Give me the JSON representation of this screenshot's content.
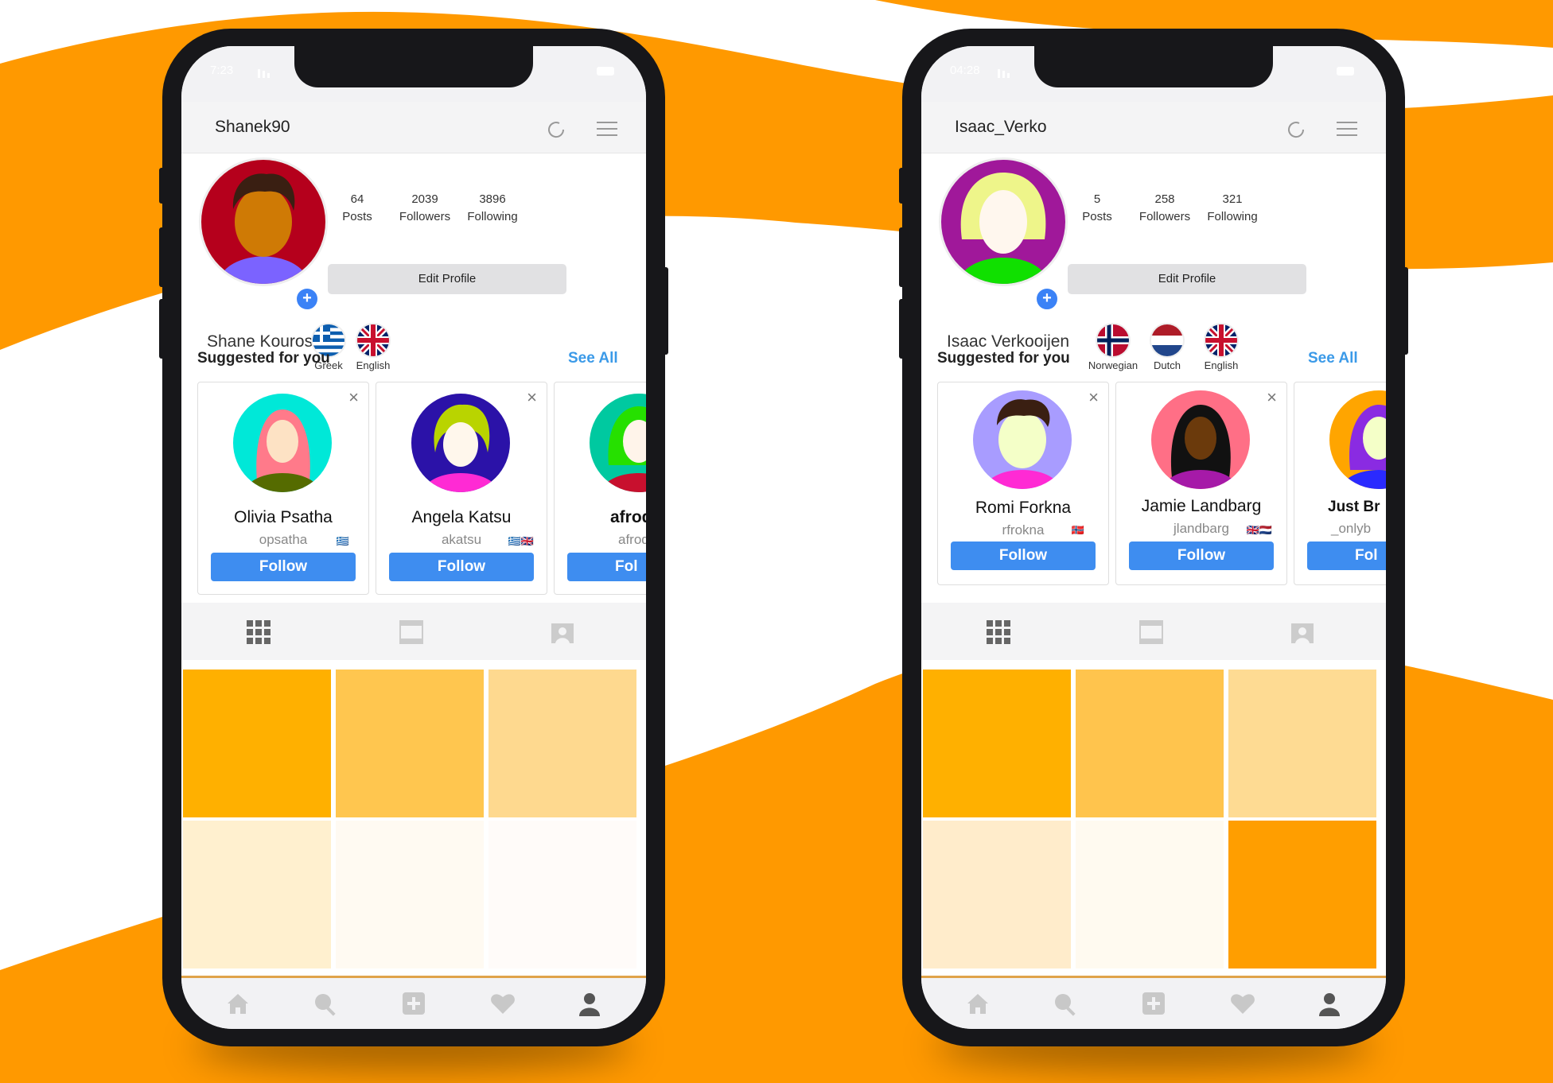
{
  "colors": {
    "accent_orange": "#ff9900",
    "follow_blue": "#3e8df0",
    "see_all_blue": "#3b9ae8"
  },
  "phones": [
    {
      "status": {
        "time": "7:23"
      },
      "username": "Shanek90",
      "stats": [
        {
          "value": "64",
          "label": "Posts"
        },
        {
          "value": "2039",
          "label": "Followers"
        },
        {
          "value": "3896",
          "label": "Following"
        }
      ],
      "edit_label": "Edit Profile",
      "full_name": "Shane Kouros",
      "languages": [
        "Greek",
        "English"
      ],
      "suggested_title": "Suggested for you",
      "see_all": "See All",
      "suggestions": [
        {
          "name": "Olivia Psatha",
          "handle": "opsatha",
          "flags": "🇬🇷",
          "follow": "Follow"
        },
        {
          "name": "Angela Katsu",
          "handle": "akatsu",
          "flags": "🇬🇷🇬🇧",
          "follow": "Follow"
        },
        {
          "name": "afrod",
          "handle": "afrod",
          "flags": "",
          "follow": "Fol"
        }
      ],
      "grid_colors": [
        "#ffb000",
        "#ffc64f",
        "#fed98f",
        "#fff0cf",
        "#fffaf2",
        "#fffbf9"
      ]
    },
    {
      "status": {
        "time": "04:28"
      },
      "username": "Isaac_Verko",
      "stats": [
        {
          "value": "5",
          "label": "Posts"
        },
        {
          "value": "258",
          "label": "Followers"
        },
        {
          "value": "321",
          "label": "Following"
        }
      ],
      "edit_label": "Edit Profile",
      "full_name": "Isaac Verkooijen",
      "languages": [
        "Norwegian",
        "Dutch",
        "English"
      ],
      "suggested_title": "Suggested for you",
      "see_all": "See All",
      "suggestions": [
        {
          "name": "Romi Forkna",
          "handle": "rfrokna",
          "flags": "🇳🇴",
          "follow": "Follow"
        },
        {
          "name": "Jamie Landbarg",
          "handle": "jlandbarg",
          "flags": "🇬🇧🇳🇱",
          "follow": "Follow"
        },
        {
          "name": "Just Br",
          "handle": "_onlyb",
          "flags": "",
          "follow": "Fol"
        }
      ],
      "grid_colors": [
        "#ffb000",
        "#ffc44d",
        "#fedb93",
        "#ffeccb",
        "#fffaf0",
        "#ff9e00"
      ]
    }
  ]
}
